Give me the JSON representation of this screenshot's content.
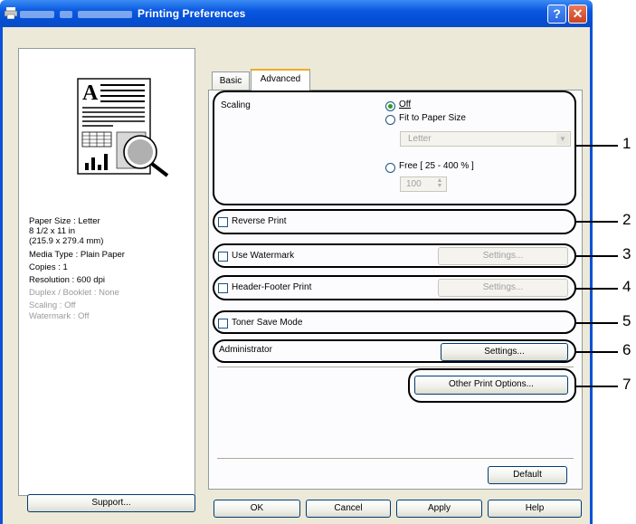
{
  "window": {
    "title": "Printing Preferences",
    "help_glyph": "?",
    "close_glyph": "✕"
  },
  "preview": {
    "paper_size": "Paper Size : Letter",
    "paper_dims": "8 1/2 x 11 in",
    "paper_mm": "(215.9 x 279.4 mm)",
    "media_type": "Media Type : Plain Paper",
    "copies": "Copies : 1",
    "resolution": "Resolution : 600 dpi",
    "duplex": "Duplex / Booklet : None",
    "scaling": "Scaling : Off",
    "watermark": "Watermark : Off",
    "support_label": "Support..."
  },
  "tabs": [
    {
      "label": "Basic"
    },
    {
      "label": "Advanced",
      "active": true
    }
  ],
  "scaling": {
    "label": "Scaling",
    "off": "Off",
    "fit": "Fit to Paper Size",
    "paper_select": "Letter",
    "free": "Free [ 25 - 400 % ]",
    "free_value": "100"
  },
  "options": {
    "reverse_print": "Reverse Print",
    "use_watermark": "Use Watermark",
    "header_footer": "Header-Footer Print",
    "toner_save": "Toner Save Mode",
    "administrator": "Administrator",
    "settings": "Settings...",
    "other_print_options": "Other Print Options...",
    "default": "Default"
  },
  "footer": {
    "ok": "OK",
    "cancel": "Cancel",
    "apply": "Apply",
    "help": "Help"
  },
  "callouts": [
    "1",
    "2",
    "3",
    "4",
    "5",
    "6",
    "7"
  ],
  "colors": {
    "titlebar": "#0a58e0",
    "dialog_bg": "#ece9d8",
    "active_tab_accent": "#f3a829",
    "radio_dot": "#21a121"
  }
}
